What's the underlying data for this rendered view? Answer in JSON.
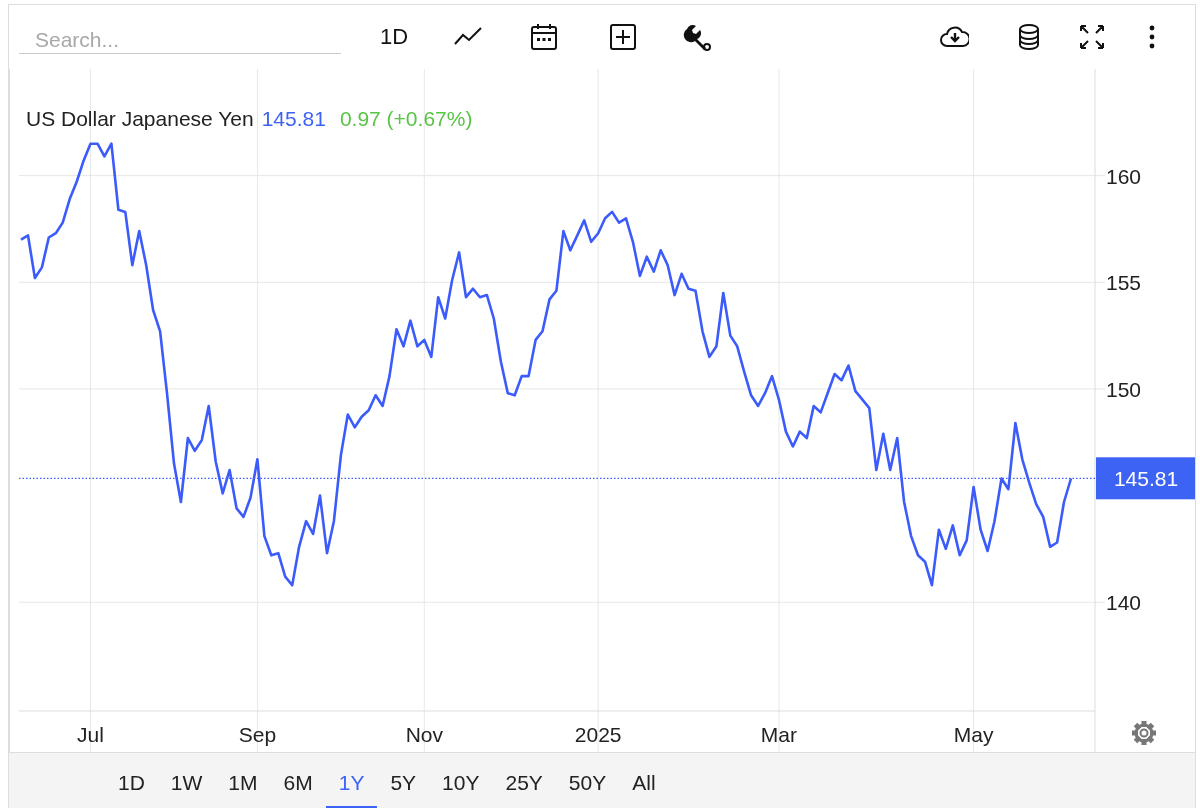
{
  "toolbar": {
    "search": {
      "placeholder": "Search..."
    },
    "interval": "1D"
  },
  "chart": {
    "legend": {
      "price": "145.81",
      "change": "0.97 (+0.67%)"
    },
    "last_price": "145.81",
    "chart_data": {
      "type": "line",
      "ylim": [
        134.9,
        165
      ],
      "grid": true,
      "categories": [
        null,
        null,
        null,
        null,
        null,
        null,
        null,
        null,
        null,
        null,
        "Jul",
        null,
        null,
        null,
        null,
        null,
        null,
        null,
        null,
        null,
        null,
        null,
        null,
        null,
        null,
        null,
        null,
        null,
        null,
        null,
        null,
        null,
        null,
        null,
        "Sep",
        null,
        null,
        null,
        null,
        null,
        null,
        null,
        null,
        null,
        null,
        null,
        null,
        null,
        null,
        null,
        null,
        null,
        null,
        null,
        null,
        null,
        null,
        null,
        "Nov",
        null,
        null,
        null,
        null,
        null,
        null,
        null,
        null,
        null,
        null,
        null,
        null,
        null,
        null,
        null,
        null,
        null,
        null,
        null,
        null,
        null,
        null,
        null,
        null,
        "2025",
        null,
        null,
        null,
        null,
        null,
        null,
        null,
        null,
        null,
        null,
        null,
        null,
        null,
        null,
        null,
        null,
        null,
        null,
        null,
        null,
        null,
        null,
        null,
        null,
        null,
        "Mar",
        null,
        null,
        null,
        null,
        null,
        null,
        null,
        null,
        null,
        null,
        null,
        null,
        null,
        null,
        null,
        null,
        null,
        null,
        null,
        null,
        null,
        null,
        null,
        null,
        null,
        null,
        null,
        "May",
        null,
        null,
        null,
        null,
        null,
        null,
        null,
        null,
        null,
        null,
        null,
        null,
        null,
        null
      ],
      "series": [
        {
          "name": "US Dollar Japanese Yen",
          "color": "#3b5bfb",
          "values": [
            157.0,
            157.2,
            155.2,
            155.7,
            157.1,
            157.3,
            157.8,
            158.9,
            159.7,
            160.7,
            161.5,
            161.5,
            160.9,
            161.5,
            158.4,
            158.3,
            155.8,
            157.4,
            155.8,
            153.7,
            152.7,
            149.8,
            146.5,
            144.7,
            147.7,
            147.1,
            147.6,
            149.2,
            146.6,
            145.1,
            146.2,
            144.4,
            144.0,
            144.9,
            146.7,
            143.1,
            142.2,
            142.3,
            141.2,
            140.8,
            142.6,
            143.8,
            143.2,
            145.0,
            142.3,
            143.8,
            146.9,
            148.8,
            148.2,
            148.7,
            149.0,
            149.7,
            149.2,
            150.6,
            152.8,
            152.0,
            153.2,
            152.0,
            152.3,
            151.5,
            154.3,
            153.3,
            155.1,
            156.4,
            154.3,
            154.7,
            154.3,
            154.4,
            153.3,
            151.3,
            149.8,
            149.7,
            150.6,
            150.6,
            152.3,
            152.7,
            154.2,
            154.6,
            157.4,
            156.5,
            157.2,
            157.9,
            156.9,
            157.3,
            158.0,
            158.3,
            157.8,
            158.0,
            156.9,
            155.3,
            156.2,
            155.5,
            156.5,
            155.8,
            154.4,
            155.4,
            154.7,
            154.6,
            152.7,
            151.5,
            152.0,
            154.5,
            152.5,
            152.0,
            150.8,
            149.7,
            149.2,
            149.8,
            150.6,
            149.5,
            148.0,
            147.3,
            148.0,
            147.7,
            149.2,
            148.9,
            149.8,
            150.7,
            150.4,
            151.1,
            149.9,
            149.5,
            149.1,
            146.2,
            147.9,
            146.2,
            147.7,
            144.7,
            143.1,
            142.2,
            141.9,
            140.8,
            143.4,
            142.5,
            143.6,
            142.2,
            142.9,
            145.4,
            143.4,
            142.4,
            143.8,
            145.8,
            145.3,
            148.4,
            146.7,
            145.6,
            144.6,
            144.0,
            142.6,
            142.8,
            144.7,
            145.8
          ]
        }
      ],
      "ref_lines": [
        {
          "axis": "y",
          "value": 145.81,
          "color": "#3b5bfb"
        }
      ],
      "yticks": [
        140,
        150,
        155,
        160
      ]
    }
  },
  "ranges": [
    {
      "label": "1D",
      "selected": false
    },
    {
      "label": "1W",
      "selected": false
    },
    {
      "label": "1M",
      "selected": false
    },
    {
      "label": "6M",
      "selected": false
    },
    {
      "label": "1Y",
      "selected": true
    },
    {
      "label": "5Y",
      "selected": false
    },
    {
      "label": "10Y",
      "selected": false
    },
    {
      "label": "25Y",
      "selected": false
    },
    {
      "label": "50Y",
      "selected": false
    },
    {
      "label": "All",
      "selected": false
    }
  ]
}
